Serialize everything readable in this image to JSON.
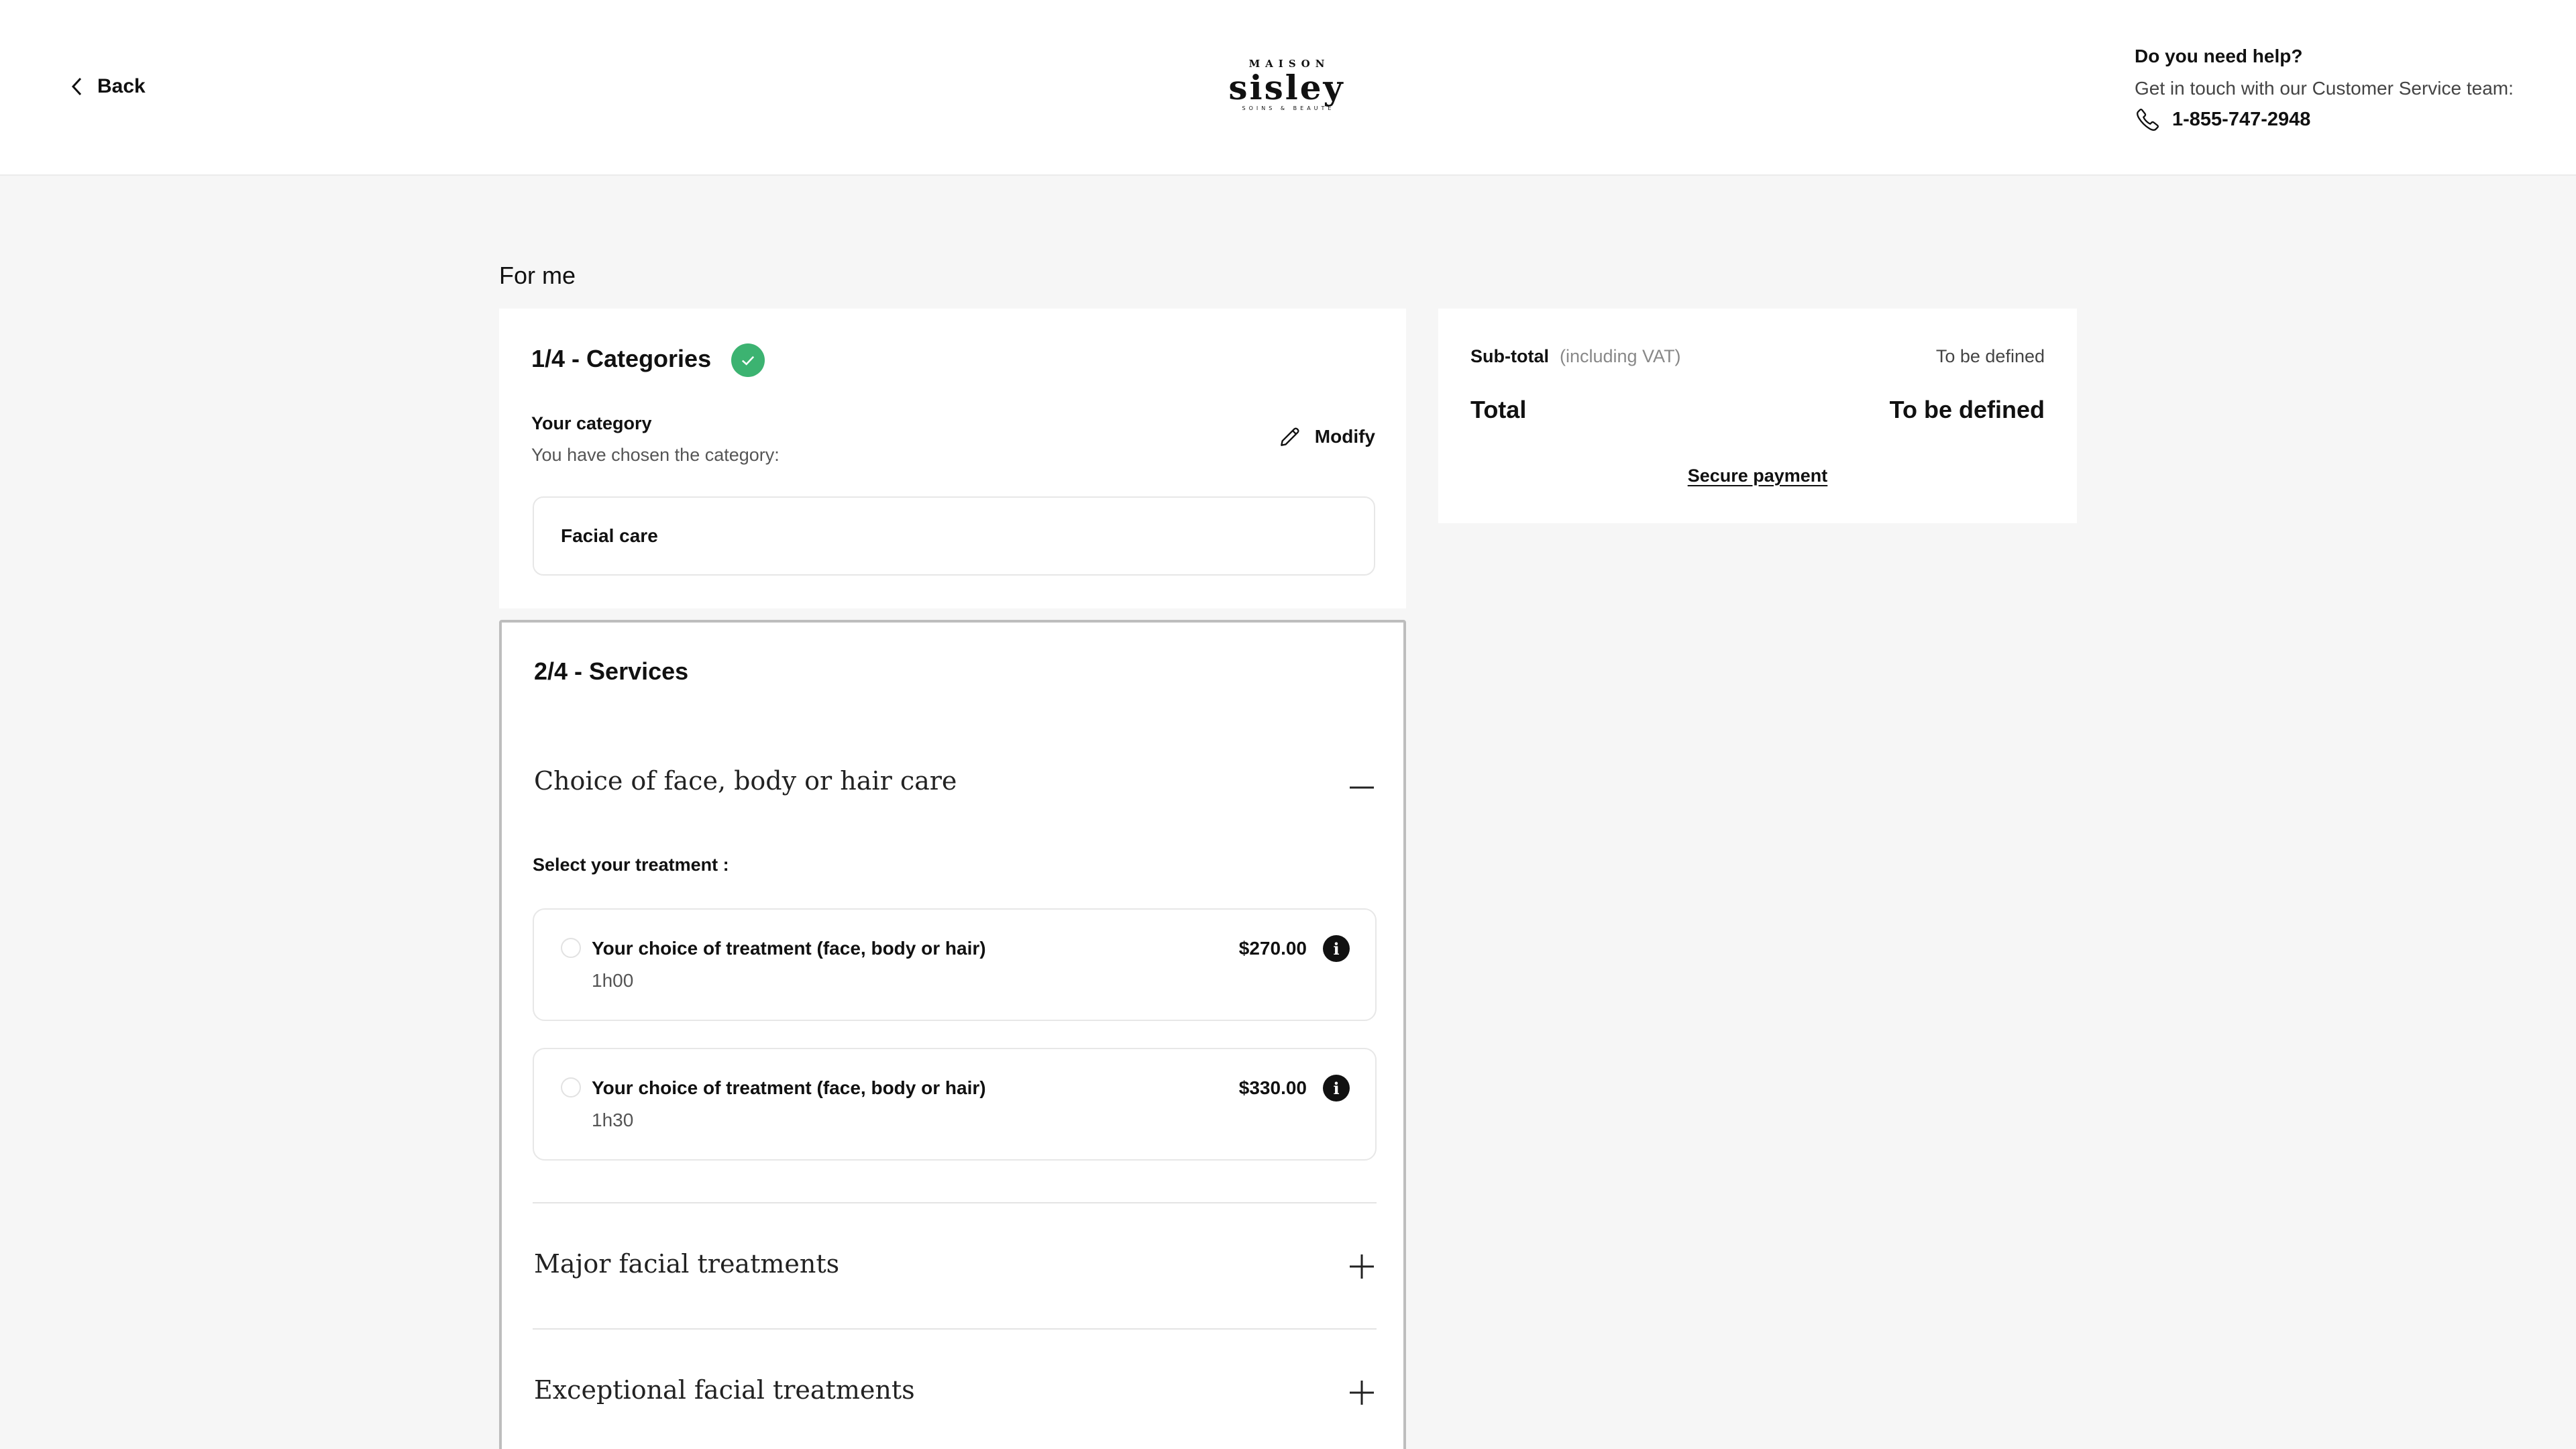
{
  "header": {
    "back_label": "Back",
    "logo": {
      "top": "MAISON",
      "main": "sisley",
      "bottom": "SOINS & BEAUTÉ"
    },
    "help": {
      "title": "Do you need help?",
      "text": "Get in touch with our Customer Service team:",
      "phone": "1-855-747-2948"
    }
  },
  "main": {
    "page_title": "For me",
    "categories": {
      "step_title": "1/4 - Categories",
      "status": "completed",
      "label": "Your category",
      "sub": "You have chosen the category:",
      "modify_label": "Modify",
      "chosen": "Facial care"
    },
    "services": {
      "step_title": "2/4 - Services",
      "accordions": [
        {
          "title": "Choice of face, body or hair care",
          "expanded": true,
          "select_label": "Select your treatment :",
          "options": [
            {
              "name": "Your choice of treatment (face, body or hair)",
              "duration": "1h00",
              "price": "$270.00"
            },
            {
              "name": "Your choice of treatment (face, body or hair)",
              "duration": "1h30",
              "price": "$330.00"
            }
          ]
        },
        {
          "title": "Major facial treatments",
          "expanded": false
        },
        {
          "title": "Exceptional facial treatments",
          "expanded": false
        }
      ]
    }
  },
  "summary": {
    "subtotal_label": "Sub-total",
    "subtotal_note": "(including VAT)",
    "subtotal_value": "To be defined",
    "total_label": "Total",
    "total_value": "To be defined",
    "secure_label": "Secure payment"
  },
  "colors": {
    "accent_check": "#3cb371",
    "page_background": "#f6f6f6",
    "panel_background": "#ffffff",
    "text": "#111111"
  },
  "icons": [
    "chevron-left-icon",
    "phone-icon",
    "check-icon",
    "pencil-icon",
    "minus-icon",
    "plus-icon",
    "info-icon"
  ]
}
